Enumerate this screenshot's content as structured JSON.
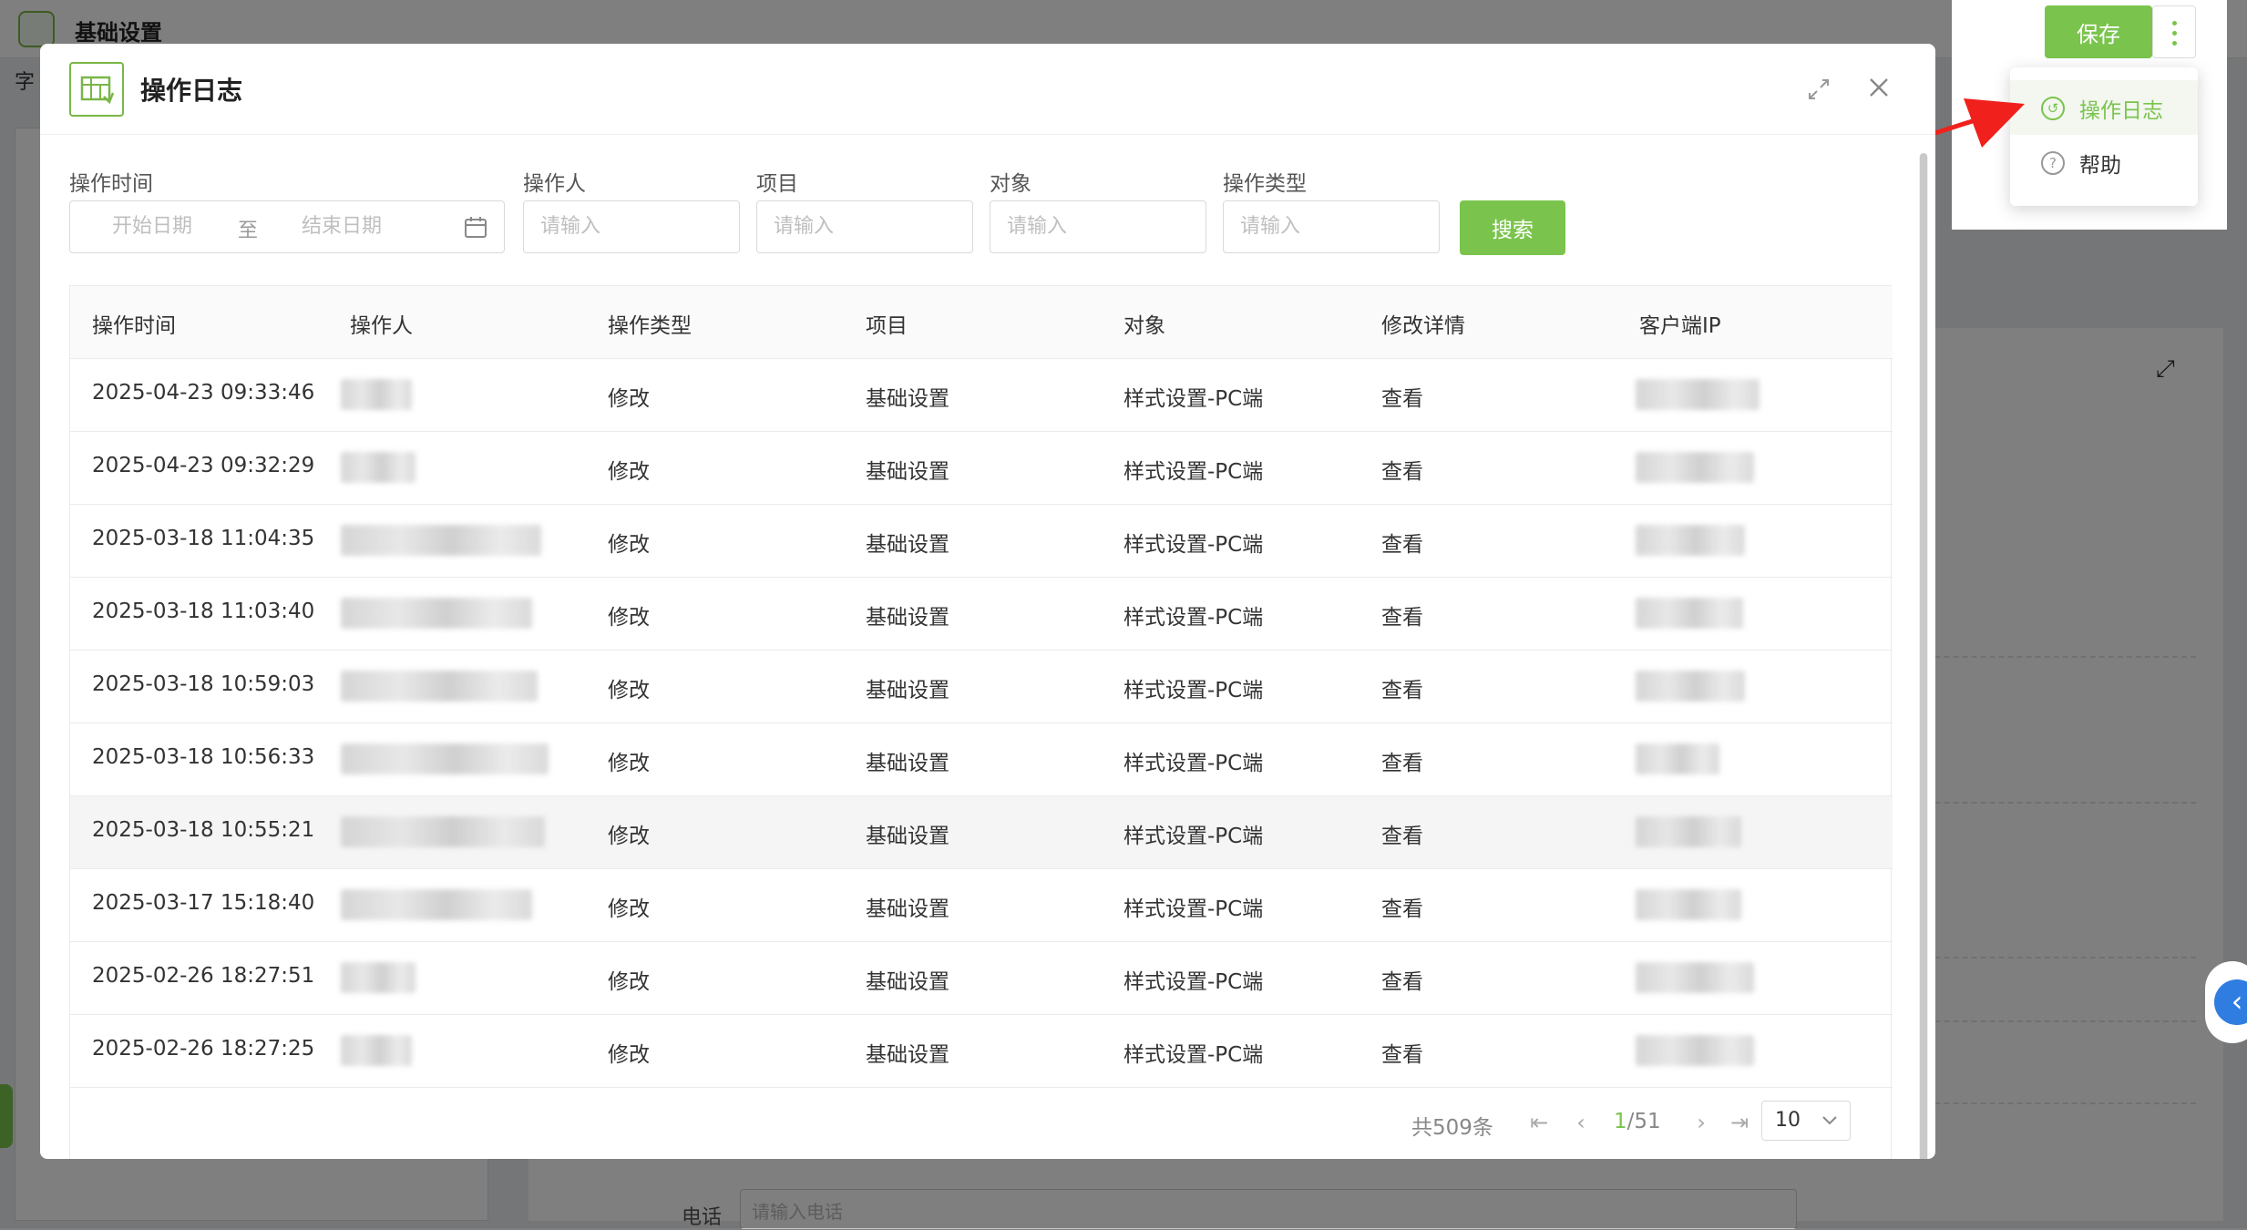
{
  "background": {
    "app_title": "基础设置",
    "side_label": "字",
    "phone_label": "电话",
    "phone_placeholder": "请输入电话"
  },
  "toolbar": {
    "save_label": "保存"
  },
  "dropdown": {
    "items": [
      {
        "label": "操作日志",
        "icon": "history-icon",
        "active": true
      },
      {
        "label": "帮助",
        "icon": "help-icon",
        "active": false
      }
    ]
  },
  "modal": {
    "title": "操作日志",
    "filters": {
      "time_label": "操作时间",
      "start_placeholder": "开始日期",
      "range_sep": "至",
      "end_placeholder": "结束日期",
      "operator_label": "操作人",
      "operator_placeholder": "请输入",
      "project_label": "项目",
      "project_placeholder": "请输入",
      "object_label": "对象",
      "object_placeholder": "请输入",
      "type_label": "操作类型",
      "type_placeholder": "请输入",
      "search_label": "搜索"
    },
    "table": {
      "columns": [
        "操作时间",
        "操作人",
        "操作类型",
        "项目",
        "对象",
        "修改详情",
        "客户端IP"
      ],
      "rows": [
        {
          "time": "2025-04-23 09:33:46",
          "type": "修改",
          "project": "基础设置",
          "object": "样式设置-PC端",
          "detail": "查看"
        },
        {
          "time": "2025-04-23 09:32:29",
          "type": "修改",
          "project": "基础设置",
          "object": "样式设置-PC端",
          "detail": "查看"
        },
        {
          "time": "2025-03-18 11:04:35",
          "type": "修改",
          "project": "基础设置",
          "object": "样式设置-PC端",
          "detail": "查看"
        },
        {
          "time": "2025-03-18 11:03:40",
          "type": "修改",
          "project": "基础设置",
          "object": "样式设置-PC端",
          "detail": "查看"
        },
        {
          "time": "2025-03-18 10:59:03",
          "type": "修改",
          "project": "基础设置",
          "object": "样式设置-PC端",
          "detail": "查看"
        },
        {
          "time": "2025-03-18 10:56:33",
          "type": "修改",
          "project": "基础设置",
          "object": "样式设置-PC端",
          "detail": "查看"
        },
        {
          "time": "2025-03-18 10:55:21",
          "type": "修改",
          "project": "基础设置",
          "object": "样式设置-PC端",
          "detail": "查看"
        },
        {
          "time": "2025-03-17 15:18:40",
          "type": "修改",
          "project": "基础设置",
          "object": "样式设置-PC端",
          "detail": "查看"
        },
        {
          "time": "2025-02-26 18:27:51",
          "type": "修改",
          "project": "基础设置",
          "object": "样式设置-PC端",
          "detail": "查看"
        },
        {
          "time": "2025-02-26 18:27:25",
          "type": "修改",
          "project": "基础设置",
          "object": "样式设置-PC端",
          "detail": "查看"
        }
      ]
    },
    "pager": {
      "total": "共509条",
      "current": "1",
      "pages": "/51",
      "page_size": "10"
    }
  },
  "colors": {
    "accent": "#7ac44d",
    "arrow": "#f0211c"
  }
}
